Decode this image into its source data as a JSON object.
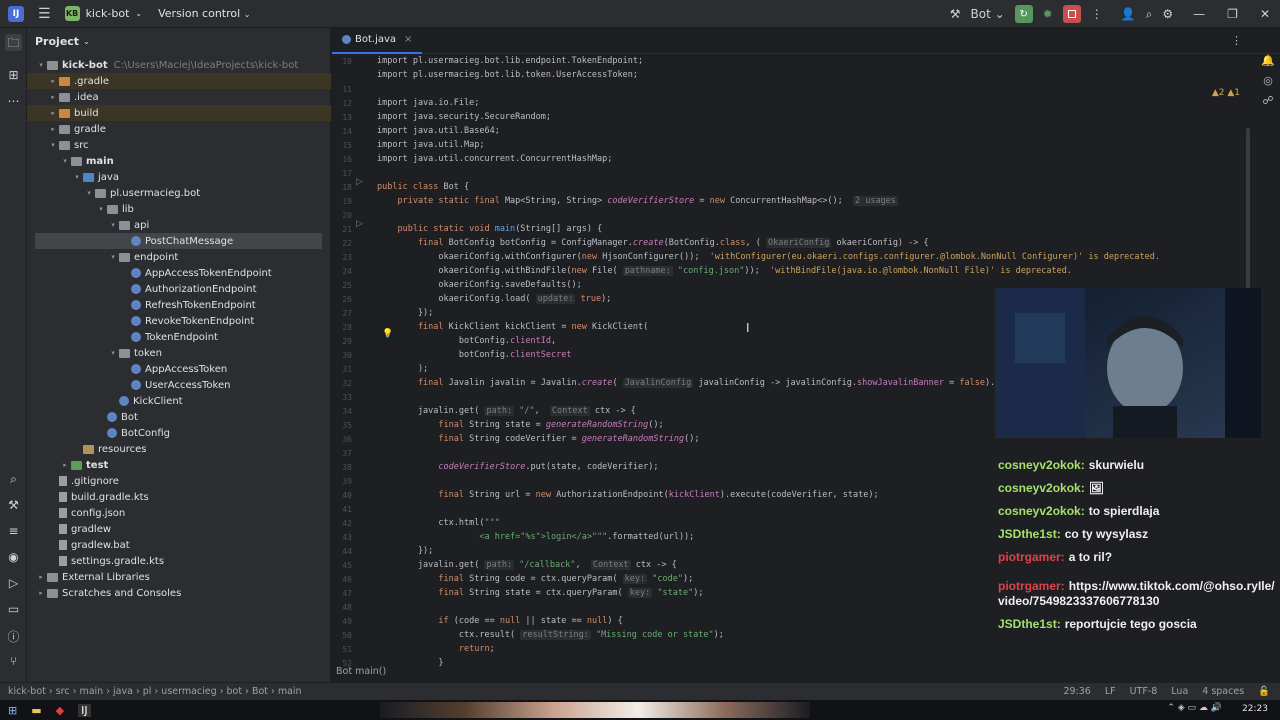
{
  "topbar": {
    "project": "kick-bot",
    "project_badge": "KB",
    "vc": "Version control",
    "run_config": "Bot"
  },
  "project_panel": {
    "title": "Project",
    "tree": [
      {
        "label": "kick-bot",
        "path": "C:\\Users\\Maciej\\IdeaProjects\\kick-bot",
        "depth": 0,
        "arrow": "▾",
        "icon": "folder",
        "bold": true
      },
      {
        "label": ".gradle",
        "depth": 1,
        "arrow": "▸",
        "icon": "folder ex",
        "hl": true
      },
      {
        "label": ".idea",
        "depth": 1,
        "arrow": "▸",
        "icon": "folder"
      },
      {
        "label": "build",
        "depth": 1,
        "arrow": "▸",
        "icon": "folder ex",
        "hl": true
      },
      {
        "label": "gradle",
        "depth": 1,
        "arrow": "▸",
        "icon": "folder"
      },
      {
        "label": "src",
        "depth": 1,
        "arrow": "▾",
        "icon": "folder"
      },
      {
        "label": "main",
        "depth": 2,
        "arrow": "▾",
        "icon": "folder",
        "bold": true
      },
      {
        "label": "java",
        "depth": 3,
        "arrow": "▾",
        "icon": "folder src"
      },
      {
        "label": "pl.usermacieg.bot",
        "depth": 4,
        "arrow": "▾",
        "icon": "folder"
      },
      {
        "label": "lib",
        "depth": 5,
        "arrow": "▾",
        "icon": "folder"
      },
      {
        "label": "api",
        "depth": 6,
        "arrow": "▾",
        "icon": "folder"
      },
      {
        "label": "PostChatMessage",
        "depth": 7,
        "arrow": "",
        "icon": "cls",
        "sel": true
      },
      {
        "label": "endpoint",
        "depth": 6,
        "arrow": "▾",
        "icon": "folder"
      },
      {
        "label": "AppAccessTokenEndpoint",
        "depth": 7,
        "arrow": "",
        "icon": "cls"
      },
      {
        "label": "AuthorizationEndpoint",
        "depth": 7,
        "arrow": "",
        "icon": "cls"
      },
      {
        "label": "RefreshTokenEndpoint",
        "depth": 7,
        "arrow": "",
        "icon": "cls"
      },
      {
        "label": "RevokeTokenEndpoint",
        "depth": 7,
        "arrow": "",
        "icon": "cls"
      },
      {
        "label": "TokenEndpoint",
        "depth": 7,
        "arrow": "",
        "icon": "cls"
      },
      {
        "label": "token",
        "depth": 6,
        "arrow": "▾",
        "icon": "folder"
      },
      {
        "label": "AppAccessToken",
        "depth": 7,
        "arrow": "",
        "icon": "cls"
      },
      {
        "label": "UserAccessToken",
        "depth": 7,
        "arrow": "",
        "icon": "cls"
      },
      {
        "label": "KickClient",
        "depth": 6,
        "arrow": "",
        "icon": "cls"
      },
      {
        "label": "Bot",
        "depth": 5,
        "arrow": "",
        "icon": "cls"
      },
      {
        "label": "BotConfig",
        "depth": 5,
        "arrow": "",
        "icon": "cls"
      },
      {
        "label": "resources",
        "depth": 3,
        "arrow": "",
        "icon": "folder res"
      },
      {
        "label": "test",
        "depth": 2,
        "arrow": "▸",
        "icon": "folder test",
        "bold": true
      },
      {
        "label": ".gitignore",
        "depth": 1,
        "arrow": "",
        "icon": "file"
      },
      {
        "label": "build.gradle.kts",
        "depth": 1,
        "arrow": "",
        "icon": "file"
      },
      {
        "label": "config.json",
        "depth": 1,
        "arrow": "",
        "icon": "file"
      },
      {
        "label": "gradlew",
        "depth": 1,
        "arrow": "",
        "icon": "file"
      },
      {
        "label": "gradlew.bat",
        "depth": 1,
        "arrow": "",
        "icon": "file"
      },
      {
        "label": "settings.gradle.kts",
        "depth": 1,
        "arrow": "",
        "icon": "file"
      },
      {
        "label": "External Libraries",
        "depth": 0,
        "arrow": "▸",
        "icon": "folder"
      },
      {
        "label": "Scratches and Consoles",
        "depth": 0,
        "arrow": "▸",
        "icon": "folder"
      }
    ]
  },
  "editor": {
    "tab": "Bot.java",
    "warnings": "▲2 ▲1",
    "line_numbers": [
      "10",
      "",
      "11",
      "12",
      "13",
      "14",
      "15",
      "16",
      "17",
      "18",
      "19",
      "20",
      "21",
      "22",
      "23",
      "24",
      "25",
      "26",
      "27",
      "28",
      "29",
      "30",
      "31",
      "32",
      "33",
      "34",
      "35",
      "36",
      "37",
      "38",
      "39",
      "40",
      "41",
      "42",
      "43",
      "44",
      "45",
      "46",
      "47",
      "48",
      "49",
      "50",
      "51",
      "52"
    ],
    "lines": [
      [
        {
          "t": "import pl.usermacieg.bot.lib.endpoint.TokenEndpoint;",
          "c": "typ"
        }
      ],
      [
        {
          "t": "import pl.usermacieg.bot.lib.token.UserAccessToken;",
          "c": "typ"
        }
      ],
      [],
      [
        {
          "t": "import java.io.File;",
          "c": "typ"
        }
      ],
      [
        {
          "t": "import java.security.SecureRandom;",
          "c": "typ"
        }
      ],
      [
        {
          "t": "import java.util.Base64;",
          "c": "typ"
        }
      ],
      [
        {
          "t": "import java.util.Map;",
          "c": "typ"
        }
      ],
      [
        {
          "t": "import java.util.concurrent.ConcurrentHashMap;",
          "c": "typ"
        }
      ],
      [],
      [
        {
          "t": "public class ",
          "c": "kw"
        },
        {
          "t": "Bot {",
          "c": "typ"
        }
      ],
      [
        {
          "t": "    private static final ",
          "c": "kw"
        },
        {
          "t": "Map<String, String> ",
          "c": "typ"
        },
        {
          "t": "codeVerifierStore",
          "c": "it"
        },
        {
          "t": " = ",
          "c": "typ"
        },
        {
          "t": "new ",
          "c": "kw"
        },
        {
          "t": "ConcurrentHashMap<>();  ",
          "c": "typ"
        },
        {
          "t": "2 usages",
          "c": "inl"
        }
      ],
      [],
      [
        {
          "t": "    public static void ",
          "c": "kw"
        },
        {
          "t": "main",
          "c": "fn"
        },
        {
          "t": "(String[] args) {",
          "c": "typ"
        }
      ],
      [
        {
          "t": "        final ",
          "c": "kw"
        },
        {
          "t": "BotConfig botConfig = ConfigManager.",
          "c": "typ"
        },
        {
          "t": "create",
          "c": "it"
        },
        {
          "t": "(BotConfig.",
          "c": "typ"
        },
        {
          "t": "class",
          "c": "kw"
        },
        {
          "t": ", ( ",
          "c": "typ"
        },
        {
          "t": "OkaeriConfig",
          "c": "inl"
        },
        {
          "t": " okaeriConfig) -> {",
          "c": "typ"
        }
      ],
      [
        {
          "t": "            okaeriConfig.",
          "c": "typ"
        },
        {
          "t": "withConfigurer",
          "c": "typ"
        },
        {
          "t": "(",
          "c": "typ"
        },
        {
          "t": "new ",
          "c": "kw"
        },
        {
          "t": "HjsonConfigurer());  ",
          "c": "typ"
        },
        {
          "t": "'withConfigurer(eu.okaeri.configs.configurer.@lombok.NonNull Configurer)' is deprecated.",
          "c": "dep"
        }
      ],
      [
        {
          "t": "            okaeriConfig.",
          "c": "typ"
        },
        {
          "t": "withBindFile",
          "c": "typ"
        },
        {
          "t": "(",
          "c": "typ"
        },
        {
          "t": "new ",
          "c": "kw"
        },
        {
          "t": "File( ",
          "c": "typ"
        },
        {
          "t": "pathname:",
          "c": "inl"
        },
        {
          "t": " \"config.json\"",
          "c": "st"
        },
        {
          "t": "));  ",
          "c": "typ"
        },
        {
          "t": "'withBindFile(java.io.@lombok.NonNull File)' is deprecated.",
          "c": "dep"
        }
      ],
      [
        {
          "t": "            okaeriConfig.saveDefaults();",
          "c": "typ"
        }
      ],
      [
        {
          "t": "            okaeriConfig.load( ",
          "c": "typ"
        },
        {
          "t": "update:",
          "c": "inl"
        },
        {
          "t": " true",
          "c": "kw"
        },
        {
          "t": ");",
          "c": "typ"
        }
      ],
      [
        {
          "t": "        });",
          "c": "typ"
        }
      ],
      [
        {
          "t": "        final ",
          "c": "kw"
        },
        {
          "t": "KickClient kickClient = ",
          "c": "typ"
        },
        {
          "t": "new ",
          "c": "kw"
        },
        {
          "t": "KickClient(",
          "c": "typ"
        }
      ],
      [
        {
          "t": "                botConfig.",
          "c": "typ"
        },
        {
          "t": "clientId",
          "c": "fld"
        },
        {
          "t": ",",
          "c": "typ"
        }
      ],
      [
        {
          "t": "                botConfig.",
          "c": "typ"
        },
        {
          "t": "clientSecret",
          "c": "fld"
        }
      ],
      [
        {
          "t": "        );",
          "c": "typ"
        }
      ],
      [
        {
          "t": "        final ",
          "c": "kw"
        },
        {
          "t": "Javalin javalin = Javalin.",
          "c": "typ"
        },
        {
          "t": "create",
          "c": "it"
        },
        {
          "t": "( ",
          "c": "typ"
        },
        {
          "t": "JavalinConfig",
          "c": "inl"
        },
        {
          "t": " javalinConfig -> javalinConfig.",
          "c": "typ"
        },
        {
          "t": "showJavalinBanner",
          "c": "fld"
        },
        {
          "t": " = ",
          "c": "typ"
        },
        {
          "t": "false",
          "c": "kw"
        },
        {
          "t": ").start( ",
          "c": "typ"
        },
        {
          "t": "port:",
          "c": "inl"
        }
      ],
      [],
      [
        {
          "t": "        javalin.get( ",
          "c": "typ"
        },
        {
          "t": "path:",
          "c": "inl"
        },
        {
          "t": " \"/\"",
          "c": "st"
        },
        {
          "t": ",  ",
          "c": "typ"
        },
        {
          "t": "Context",
          "c": "inl"
        },
        {
          "t": " ctx -> {",
          "c": "typ"
        }
      ],
      [
        {
          "t": "            final ",
          "c": "kw"
        },
        {
          "t": "String state = ",
          "c": "typ"
        },
        {
          "t": "generateRandomString",
          "c": "it"
        },
        {
          "t": "();",
          "c": "typ"
        }
      ],
      [
        {
          "t": "            final ",
          "c": "kw"
        },
        {
          "t": "String codeVerifier = ",
          "c": "typ"
        },
        {
          "t": "generateRandomString",
          "c": "it"
        },
        {
          "t": "();",
          "c": "typ"
        }
      ],
      [],
      [
        {
          "t": "            ",
          "c": "typ"
        },
        {
          "t": "codeVerifierStore",
          "c": "it"
        },
        {
          "t": ".put(state, codeVerifier);",
          "c": "typ"
        }
      ],
      [],
      [
        {
          "t": "            final ",
          "c": "kw"
        },
        {
          "t": "String url = ",
          "c": "typ"
        },
        {
          "t": "new ",
          "c": "kw"
        },
        {
          "t": "AuthorizationEndpoint(",
          "c": "typ"
        },
        {
          "t": "kickClient",
          "c": "fld"
        },
        {
          "t": ").execute(codeVerifier, state);",
          "c": "typ"
        }
      ],
      [],
      [
        {
          "t": "            ctx.html(",
          "c": "typ"
        },
        {
          "t": "\"\"\"",
          "c": "st"
        }
      ],
      [
        {
          "t": "                    <a href=\"%s\">login</a>\"\"\"",
          "c": "st"
        },
        {
          "t": ".formatted(url));",
          "c": "typ"
        }
      ],
      [
        {
          "t": "        });",
          "c": "typ"
        }
      ],
      [
        {
          "t": "        javalin.get( ",
          "c": "typ"
        },
        {
          "t": "path:",
          "c": "inl"
        },
        {
          "t": " \"/callback\"",
          "c": "st"
        },
        {
          "t": ",  ",
          "c": "typ"
        },
        {
          "t": "Context",
          "c": "inl"
        },
        {
          "t": " ctx -> {",
          "c": "typ"
        }
      ],
      [
        {
          "t": "            final ",
          "c": "kw"
        },
        {
          "t": "String code = ctx.queryParam( ",
          "c": "typ"
        },
        {
          "t": "key:",
          "c": "inl"
        },
        {
          "t": " \"code\"",
          "c": "st"
        },
        {
          "t": ");",
          "c": "typ"
        }
      ],
      [
        {
          "t": "            final ",
          "c": "kw"
        },
        {
          "t": "String state = ctx.queryParam( ",
          "c": "typ"
        },
        {
          "t": "key:",
          "c": "inl"
        },
        {
          "t": " \"state\"",
          "c": "st"
        },
        {
          "t": ");",
          "c": "typ"
        }
      ],
      [],
      [
        {
          "t": "            if ",
          "c": "kw"
        },
        {
          "t": "(code == ",
          "c": "typ"
        },
        {
          "t": "null ",
          "c": "kw"
        },
        {
          "t": "|| state == ",
          "c": "typ"
        },
        {
          "t": "null",
          "c": "kw"
        },
        {
          "t": ") {",
          "c": "typ"
        }
      ],
      [
        {
          "t": "                ctx.result( ",
          "c": "typ"
        },
        {
          "t": "resultString:",
          "c": "inl"
        },
        {
          "t": " \"Missing code or state\"",
          "c": "st"
        },
        {
          "t": ");",
          "c": "typ"
        }
      ],
      [
        {
          "t": "                return",
          "c": "kw"
        },
        {
          "t": ";",
          "c": "typ"
        }
      ],
      [
        {
          "t": "            }",
          "c": "typ"
        }
      ]
    ],
    "crumbs": "Bot    main()"
  },
  "statusbar": {
    "path": [
      "kick-bot",
      "src",
      "main",
      "java",
      "pl",
      "usermacieg",
      "bot",
      "Bot",
      "main"
    ],
    "position": "29:36",
    "line_sep": "LF",
    "encoding": "UTF-8",
    "lang": "Lua",
    "indent": "4 spaces"
  },
  "taskbar": {
    "time": "22:23"
  },
  "chat": [
    {
      "user": "cosneyv2okok:",
      "text": "skurwielu",
      "color": "u-green"
    },
    {
      "user": "cosneyv2okok:",
      "text": "🖼",
      "color": "u-green"
    },
    {
      "user": "cosneyv2okok:",
      "text": "to spierdlaja",
      "color": "u-green"
    },
    {
      "user": "JSDthe1st:",
      "text": "co ty wysylasz",
      "color": "u-green"
    },
    {
      "user": "piotrgamer:",
      "text": "a to ril?",
      "color": "u-red"
    },
    {
      "user": "piotrgamer:",
      "text": "https://www.tiktok.com/@ohso.ryIle/video/7549823337606778130",
      "color": "u-red"
    },
    {
      "user": "JSDthe1st:",
      "text": "reportujcie tego goscia",
      "color": "u-green"
    }
  ]
}
